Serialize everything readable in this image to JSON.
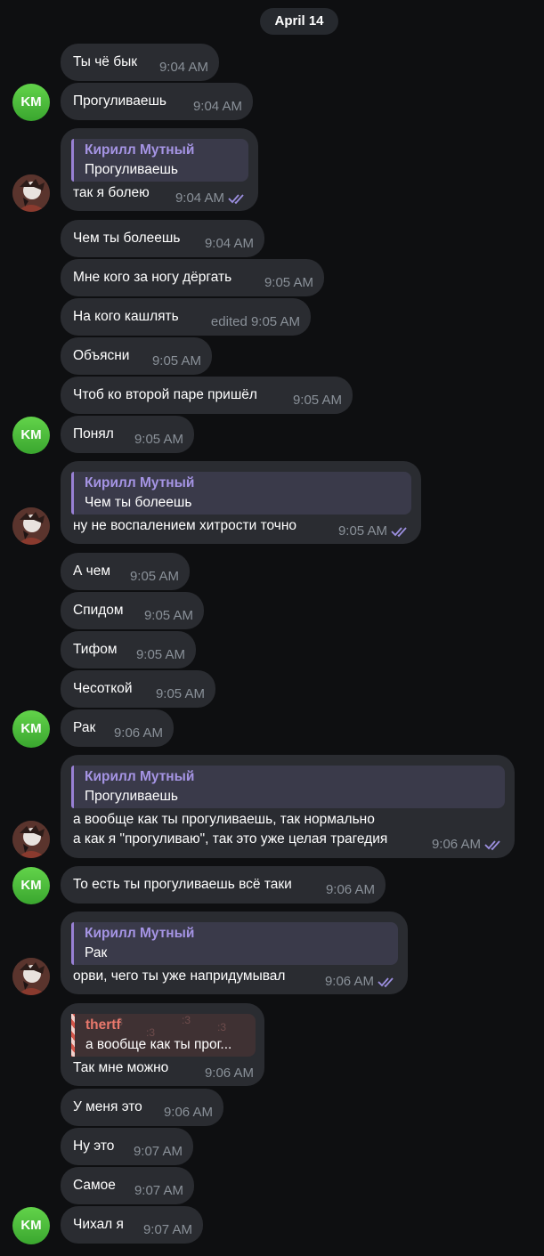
{
  "date": "April 14",
  "sender_name": "Кирилл Мутный",
  "sender_initials": "KM",
  "colors": {
    "background": "#0e0f11",
    "bubble": "#2a2c31",
    "time": "#8a9199",
    "quote_accent": "#9880d4",
    "read_ticks": "#9c8fe0",
    "avatar_green": "#4cbf3c"
  },
  "icons": {
    "read_receipt": "double-check-icon",
    "avatar": "user-photo"
  },
  "messages": [
    {
      "text": "Ты чё бык",
      "time": "9:04 AM"
    },
    {
      "text": "Прогуливаешь",
      "time": "9:04 AM"
    },
    {
      "quote_name": "Кирилл Мутный",
      "quote_text": "Прогуливаешь",
      "text": "так я болею",
      "time": "9:04 AM"
    },
    {
      "text": "Чем ты болеешь",
      "time": "9:04 AM"
    },
    {
      "text": "Мне кого за ногу дёргать",
      "time": "9:05 AM"
    },
    {
      "text": "На кого кашлять",
      "time": "edited 9:05 AM"
    },
    {
      "text": "Объясни",
      "time": "9:05 AM"
    },
    {
      "text": "Чтоб ко второй паре пришёл",
      "time": "9:05 AM"
    },
    {
      "text": "Понял",
      "time": "9:05 AM"
    },
    {
      "quote_name": "Кирилл Мутный",
      "quote_text": "Чем ты болеешь",
      "text": "ну не воспалением хитрости точно",
      "time": "9:05 AM"
    },
    {
      "text": "А чем",
      "time": "9:05 AM"
    },
    {
      "text": "Спидом",
      "time": "9:05 AM"
    },
    {
      "text": "Тифом",
      "time": "9:05 AM"
    },
    {
      "text": "Чесоткой",
      "time": "9:05 AM"
    },
    {
      "text": "Рак",
      "time": "9:06 AM"
    },
    {
      "quote_name": "Кирилл Мутный",
      "quote_text": "Прогуливаешь",
      "text": "а вообще как ты прогуливаешь, так нормально",
      "text2": "а как я \"прогуливаю\", так это уже целая трагедия",
      "time": "9:06 AM"
    },
    {
      "text": "То есть ты прогуливаешь всё таки",
      "time": "9:06 AM"
    },
    {
      "quote_name": "Кирилл Мутный",
      "quote_text": "Рак",
      "text": "орви, чего ты уже напридумывал",
      "time": "9:06 AM"
    },
    {
      "quote_name": "thertf",
      "quote_text": "а вообще как ты прог...",
      "text": "Так мне можно",
      "time": "9:06 AM"
    },
    {
      "text": "У меня это",
      "time": "9:06 AM"
    },
    {
      "text": "Ну это",
      "time": "9:07 AM"
    },
    {
      "text": "Самое",
      "time": "9:07 AM"
    },
    {
      "text": "Чихал я",
      "time": "9:07 AM"
    }
  ]
}
